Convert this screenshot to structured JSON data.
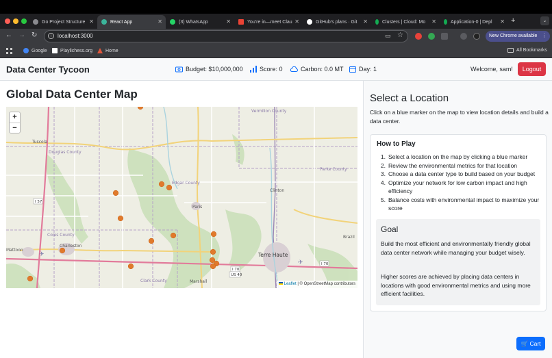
{
  "browser": {
    "tabs": [
      {
        "title": "Go Project Structure",
        "icon_color": "#8a8a8f"
      },
      {
        "title": "React App",
        "icon_color": "#3bb49a"
      },
      {
        "title": "(3) WhatsApp",
        "icon_color": "#25d366"
      },
      {
        "title": "You're in—meet Clau",
        "icon_color": "#ea4335"
      },
      {
        "title": "GitHub's plans · Git",
        "icon_color": "#ffffff"
      },
      {
        "title": "Clusters | Cloud: Mo",
        "icon_color": "#13aa52"
      },
      {
        "title": "Application-0 | Depl",
        "icon_color": "#13aa52"
      }
    ],
    "url": "localhost:3000",
    "new_chrome_label": "New Chrome available",
    "bookmarks": [
      {
        "label": "Google",
        "icon_color": "#4285f4"
      },
      {
        "label": "Playlichess.org",
        "icon_color": "#ffffff"
      },
      {
        "label": "Home",
        "icon_color": "#e0563b"
      }
    ],
    "all_bookmarks_label": "All Bookmarks"
  },
  "header": {
    "title": "Data Center Tycoon",
    "budget": "Budget: $10,000,000",
    "score": "Score: 0",
    "carbon": "Carbon: 0.0 MT",
    "day": "Day: 1",
    "welcome": "Welcome, sam!",
    "logout_label": "Logout"
  },
  "map": {
    "title": "Global Data Center Map",
    "zoom_in": "+",
    "zoom_out": "−",
    "attribution_leaflet": "Leaflet",
    "attribution_rest": "| © OpenStreetMap contributors",
    "place_labels": [
      {
        "name": "Tuscola"
      },
      {
        "name": "Vermilion County"
      },
      {
        "name": "Douglas County"
      },
      {
        "name": "Edgar County"
      },
      {
        "name": "Clinton"
      },
      {
        "name": "Parke County"
      },
      {
        "name": "Paris"
      },
      {
        "name": "Coles County"
      },
      {
        "name": "Charleston"
      },
      {
        "name": "Mattoon"
      },
      {
        "name": "Brazil"
      },
      {
        "name": "Terre Haute"
      },
      {
        "name": "Marshall"
      },
      {
        "name": "Clark County"
      },
      {
        "name": "I 57"
      },
      {
        "name": "I 70"
      },
      {
        "name": "US 40"
      }
    ],
    "marker_color": "#e07a2c"
  },
  "panel": {
    "select_title": "Select a Location",
    "select_desc": "Click on a blue marker on the map to view location details and build a data center.",
    "howto_title": "How to Play",
    "steps": [
      {
        "num": "1.",
        "text": "Select a location on the map by clicking a blue marker"
      },
      {
        "num": "2.",
        "text": "Review the environmental metrics for that location"
      },
      {
        "num": "3.",
        "text": "Choose a data center type to build based on your budget"
      },
      {
        "num": "4.",
        "text": "Optimize your network for low carbon impact and high efficiency"
      },
      {
        "num": "5.",
        "text": "Balance costs with environmental impact to maximize your score"
      }
    ],
    "goal_title": "Goal",
    "goal_p1": "Build the most efficient and environmentally friendly global data center network while managing your budget wisely.",
    "goal_p2": "Higher scores are achieved by placing data centers in locations with good environmental metrics and using more efficient facilities."
  },
  "cart_label": "Cart"
}
